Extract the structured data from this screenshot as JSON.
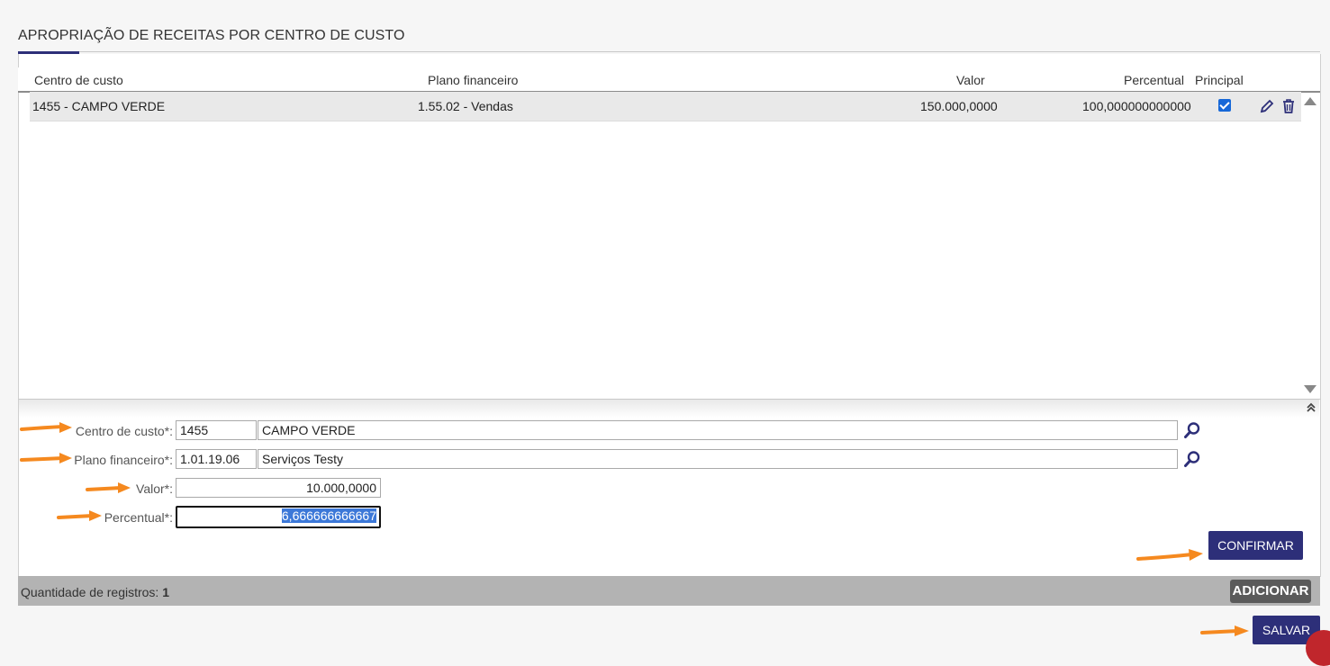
{
  "section": {
    "title": "APROPRIAÇÃO DE RECEITAS POR CENTRO DE CUSTO"
  },
  "grid": {
    "columns": {
      "centro": "Centro de custo",
      "plano": "Plano financeiro",
      "valor": "Valor",
      "percentual": "Percentual",
      "principal": "Principal"
    },
    "rows": [
      {
        "centro": "1455 - CAMPO VERDE",
        "plano": "1.55.02 - Vendas",
        "valor": "150.000,0000",
        "percentual": "100,000000000000",
        "principal": true
      }
    ]
  },
  "form": {
    "centro_label": "Centro de custo*:",
    "centro_code": "1455",
    "centro_name": "CAMPO VERDE",
    "plano_label": "Plano financeiro*:",
    "plano_code": "1.01.19.06",
    "plano_name": "Serviços Testy",
    "valor_label": "Valor*:",
    "valor_value": "10.000,0000",
    "percentual_label": "Percentual*:",
    "percentual_value": "6,666666666667",
    "confirm_label": "CONFIRMAR"
  },
  "footer": {
    "count_label": "Quantidade de registros:",
    "count_value": "1",
    "add_label": "ADICIONAR"
  },
  "actions": {
    "save_label": "SALVAR"
  },
  "colors": {
    "primary": "#2d2f79",
    "accent_arrow": "#f5891f",
    "checkbox": "#1768d8"
  }
}
